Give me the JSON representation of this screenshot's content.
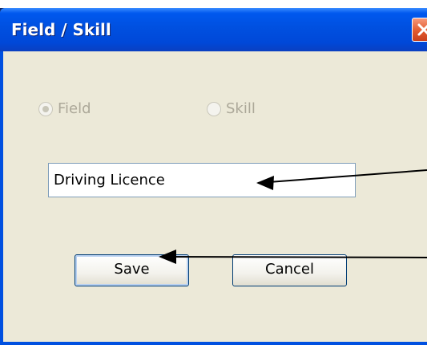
{
  "window": {
    "title": "Field / Skill",
    "close_icon": "close-icon"
  },
  "radios": {
    "field_label": "Field",
    "skill_label": "Skill",
    "selected": "Field",
    "disabled": true
  },
  "input": {
    "value": "Driving Licence"
  },
  "buttons": {
    "save_label": "Save",
    "cancel_label": "Cancel"
  },
  "annotations": {
    "arrow_icon": "arrow-left-icon"
  },
  "colors": {
    "titlebar": "#0050e0",
    "client_bg": "#ece9d8",
    "close_button": "#e35a2e",
    "disabled_text": "#aca899"
  }
}
